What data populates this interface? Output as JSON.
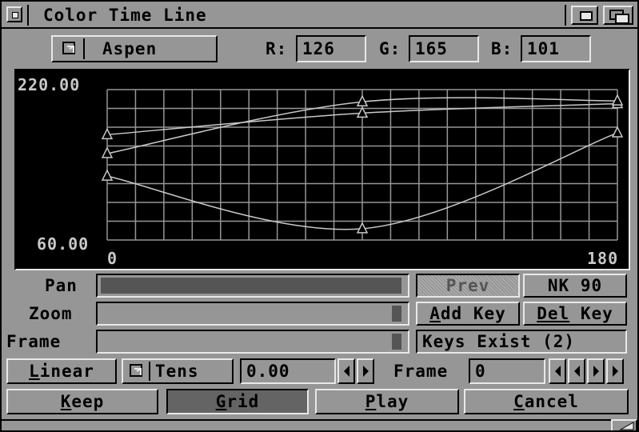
{
  "window": {
    "title": "Color Time Line"
  },
  "header": {
    "palette_button_label": "Aspen",
    "r_label": "R:",
    "r_value": "126",
    "g_label": "G:",
    "g_value": "165",
    "b_label": "B:",
    "b_value": "101"
  },
  "graph": {
    "y_max_label": "220.00",
    "y_min_label": "60.00",
    "x_min_label": "0",
    "x_max_label": "180",
    "colors": {
      "background": "#000000",
      "grid": "#969696",
      "curve": "#c8c8c8"
    }
  },
  "chart_data": {
    "type": "line",
    "xlim": [
      0,
      180
    ],
    "ylim": [
      60,
      220
    ],
    "grid": true,
    "series": [
      {
        "x": [
          0,
          90,
          180
        ],
        "y": [
          172,
          195,
          205
        ]
      },
      {
        "x": [
          0,
          90,
          180
        ],
        "y": [
          152,
          207,
          208
        ]
      },
      {
        "x": [
          0,
          90,
          180
        ],
        "y": [
          128,
          72,
          174
        ]
      }
    ]
  },
  "controls": {
    "pan_label": "Pan",
    "zoom_label": "Zoom",
    "frame_label": "Frame",
    "prev_button": "Prev",
    "nk_button": "NK 90",
    "add_key_prefix": "A",
    "add_key_rest": "dd Key",
    "del_key_prefix": "D",
    "del_key_mid": "el",
    "del_key_rest": " Key",
    "keys_status": "Keys Exist (2)",
    "linear_prefix": "L",
    "linear_rest": "inear",
    "tens_label": "Tens",
    "tens_value": "0.00",
    "frame_field_label": "Frame",
    "frame_value": "0"
  },
  "footer": {
    "keep_prefix": "K",
    "keep_rest": "eep",
    "grid_prefix": "G",
    "grid_rest": "rid",
    "play_prefix": "P",
    "play_rest": "lay",
    "cancel_prefix": "C",
    "cancel_rest": "ancel"
  }
}
